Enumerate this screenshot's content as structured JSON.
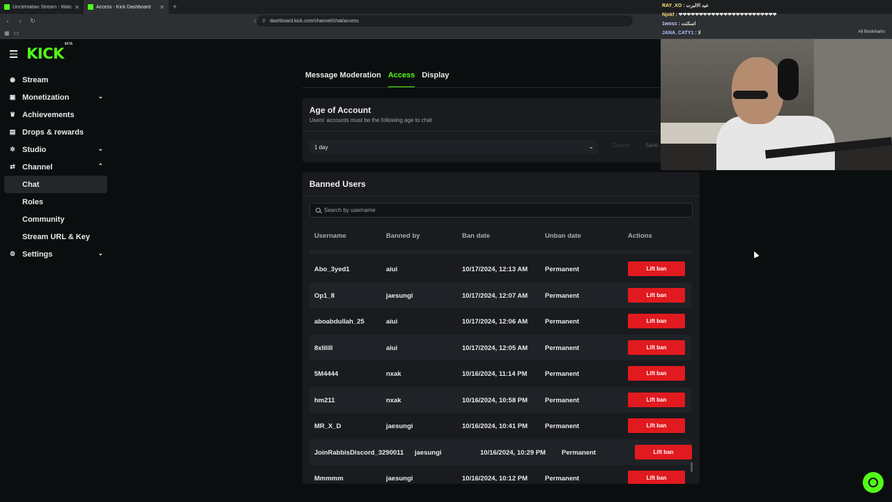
{
  "browser": {
    "tabs": [
      {
        "title": "UncleHattan Stream - Watch Live on",
        "active": false
      },
      {
        "title": "Access - Kick Dashboard",
        "active": true
      }
    ],
    "url": "dashboard.kick.com/channel/chat/access",
    "bookmarks_label": "All Bookmarks"
  },
  "overlay_chat": [
    {
      "user": "RAY_XO",
      "text": "عيد الالبرت"
    },
    {
      "user": "Njokf",
      "text": "❤❤❤❤❤❤❤❤❤❤❤❤❤❤❤❤❤❤❤❤❤❤❤❤"
    },
    {
      "user": "1woss",
      "text": "اسكتت"
    },
    {
      "user": "JANA_CATY1",
      "text": "لا"
    }
  ],
  "brand": {
    "logo": "KICK",
    "beta": "BETA",
    "accent": "#53fc18"
  },
  "sidebar": {
    "items": [
      {
        "label": "Stream",
        "icon": "stream-icon",
        "chevron": ""
      },
      {
        "label": "Monetization",
        "icon": "wallet-icon",
        "chevron": "down"
      },
      {
        "label": "Achievements",
        "icon": "trophy-icon",
        "chevron": ""
      },
      {
        "label": "Drops & rewards",
        "icon": "gift-icon",
        "chevron": ""
      },
      {
        "label": "Studio",
        "icon": "studio-icon",
        "chevron": "down"
      },
      {
        "label": "Channel",
        "icon": "channel-icon",
        "chevron": "up"
      },
      {
        "label": "Chat",
        "sub": true,
        "selected": true
      },
      {
        "label": "Roles",
        "sub": true
      },
      {
        "label": "Community",
        "sub": true
      },
      {
        "label": "Stream URL & Key",
        "sub": true
      },
      {
        "label": "Settings",
        "icon": "gear-icon",
        "chevron": "down"
      }
    ]
  },
  "tabs": {
    "items": [
      "Message Moderation",
      "Access",
      "Display"
    ],
    "active": "Access"
  },
  "age_of_account": {
    "title": "Age of Account",
    "description": "Users' accounts must be the following age to chat",
    "value": "1 day",
    "cancel_label": "Cancel",
    "save_label": "Save"
  },
  "banned_users": {
    "title": "Banned Users",
    "search_placeholder": "Search by username",
    "columns": [
      "Username",
      "Banned by",
      "Ban date",
      "Unban date",
      "Actions"
    ],
    "action_label": "Lift ban",
    "rows": [
      {
        "username": "Abo_3yed1",
        "banned_by": "aiui",
        "ban_date": "10/17/2024, 12:13 AM",
        "unban_date": "Permanent"
      },
      {
        "username": "Op1_8",
        "banned_by": "jaesungi",
        "ban_date": "10/17/2024, 12:07 AM",
        "unban_date": "Permanent"
      },
      {
        "username": "aboabdullah_25",
        "banned_by": "aiui",
        "ban_date": "10/17/2024, 12:06 AM",
        "unban_date": "Permanent"
      },
      {
        "username": "8xlilill",
        "banned_by": "aiui",
        "ban_date": "10/17/2024, 12:05 AM",
        "unban_date": "Permanent"
      },
      {
        "username": "5M4444",
        "banned_by": "nxak",
        "ban_date": "10/16/2024, 11:14 PM",
        "unban_date": "Permanent"
      },
      {
        "username": "hm211",
        "banned_by": "nxak",
        "ban_date": "10/16/2024, 10:58 PM",
        "unban_date": "Permanent"
      },
      {
        "username": "MR_X_D",
        "banned_by": "jaesungi",
        "ban_date": "10/16/2024, 10:41 PM",
        "unban_date": "Permanent"
      },
      {
        "username": "JoinRabbisDiscord_3290011",
        "banned_by": "jaesungi",
        "ban_date": "10/16/2024, 10:29 PM",
        "unban_date": "Permanent"
      },
      {
        "username": "Mmmmm",
        "banned_by": "jaesungi",
        "ban_date": "10/16/2024, 10:12 PM",
        "unban_date": "Permanent"
      }
    ]
  },
  "colors": {
    "danger": "#e11a1f",
    "background": "#0b0e0f",
    "card": "#191b1f"
  }
}
